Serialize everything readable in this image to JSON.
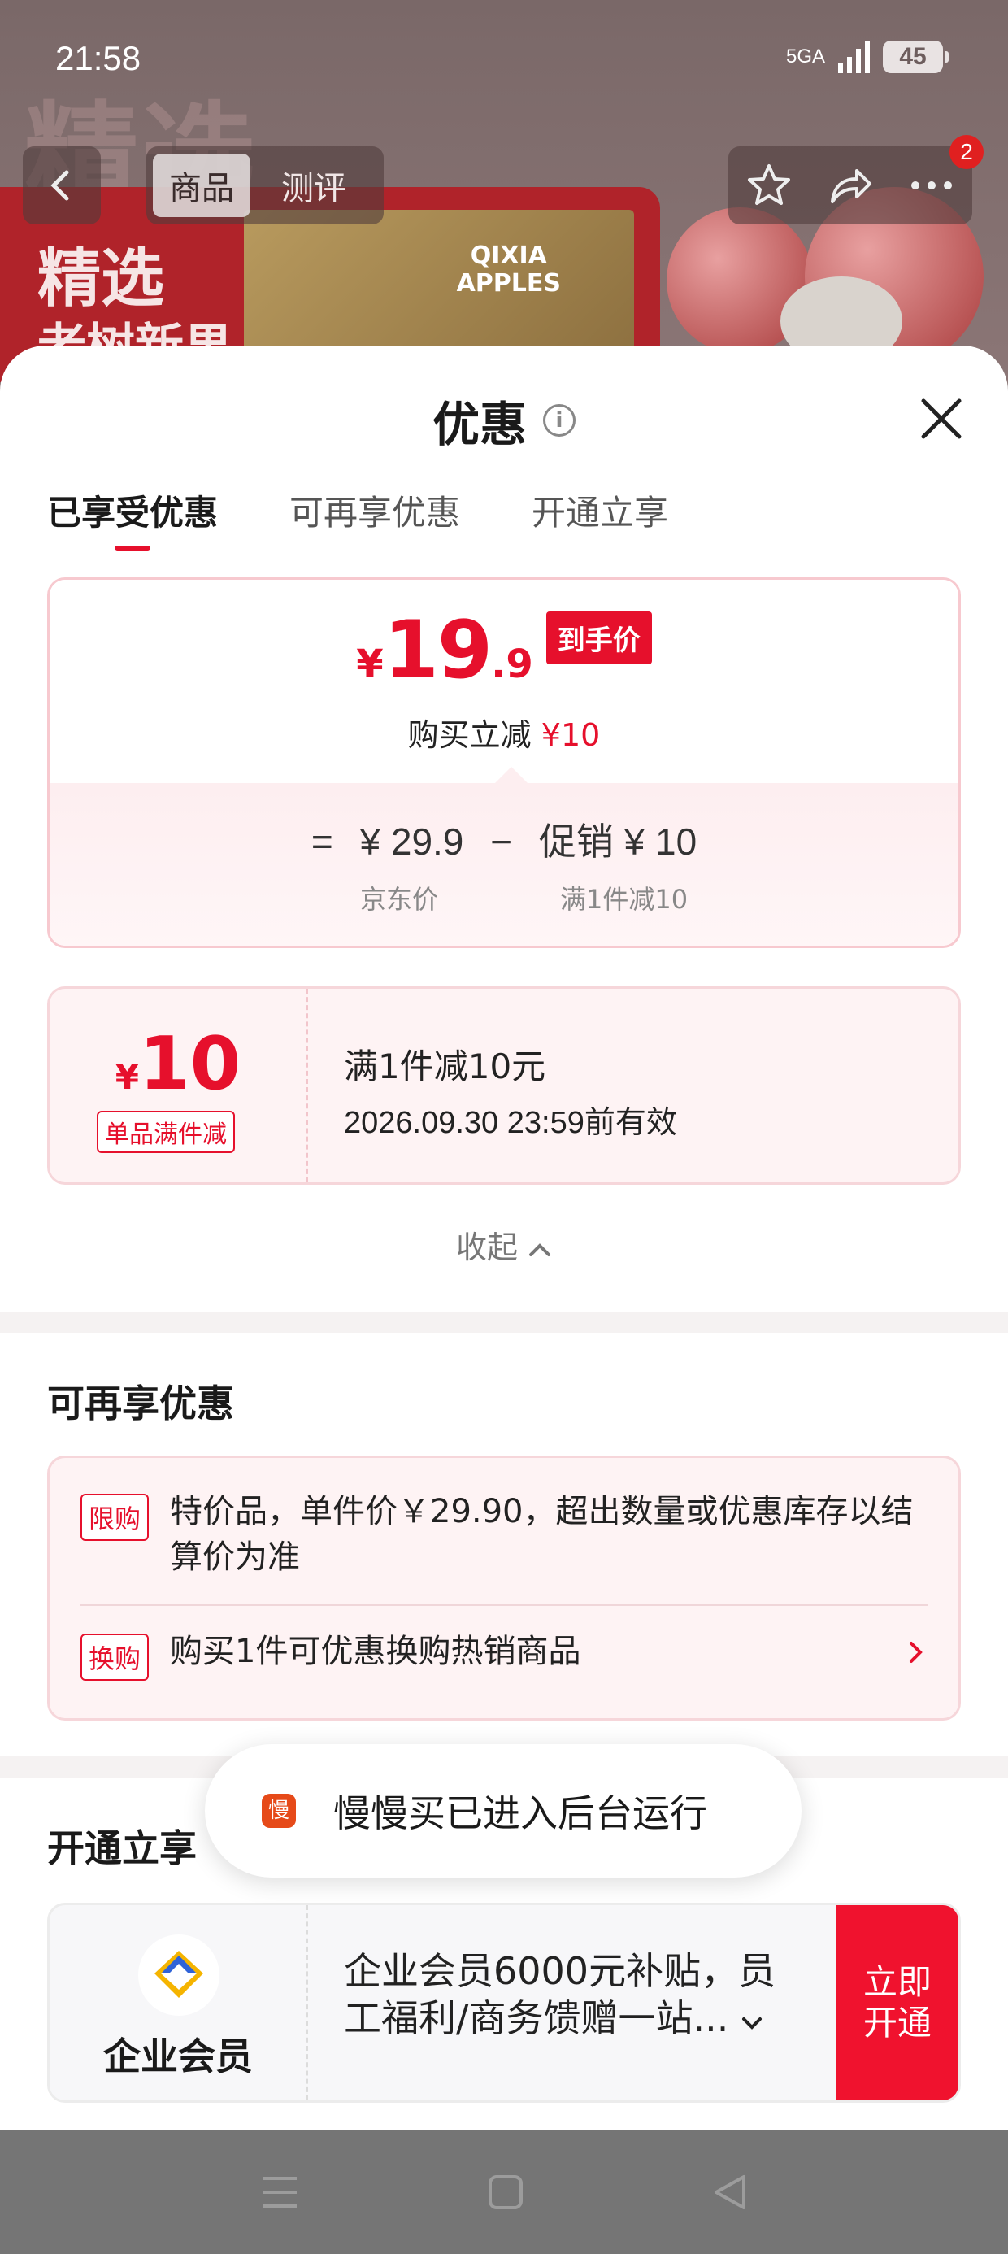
{
  "status_bar": {
    "time": "21:58",
    "network": "5GA",
    "battery": "45"
  },
  "background": {
    "ghost_text": "精选",
    "banner_line1": "精选",
    "banner_line2": "老树新果",
    "box_logo": "QIXIA\nAPPLES"
  },
  "top_nav": {
    "tabs": [
      "商品",
      "测评"
    ],
    "active_tab": 0,
    "badge": "2"
  },
  "sheet": {
    "title": "优惠",
    "tabs": [
      "已享受优惠",
      "可再享优惠",
      "开通立享"
    ]
  },
  "price_card": {
    "currency": "¥",
    "price_int": "19",
    "price_dec": ".9",
    "tag": "到手价",
    "reduce_label": "购买立减",
    "reduce_amount": "¥10",
    "eq": "=",
    "orig_price": "¥ 29.9",
    "minus": "−",
    "promo": "促销 ¥ 10",
    "orig_label": "京东价",
    "promo_label": "满1件减10"
  },
  "coupon": {
    "currency": "¥",
    "amount": "10",
    "tag": "单品满件减",
    "title": "满1件减10元",
    "validity": "2026.09.30 23:59前有效"
  },
  "collapse_label": "收起",
  "more_section": {
    "title": "可再享优惠",
    "items": [
      {
        "pill": "限购",
        "text": "特价品，单件价￥29.90，超出数量或优惠库存以结算价为准"
      },
      {
        "pill": "换购",
        "text": "购买1件可优惠换购热销商品"
      }
    ]
  },
  "open_section": {
    "title": "开通立享",
    "vip_name": "企业会员",
    "vip_desc": "企业会员6000元补贴，员工福利/商务馈赠一站...",
    "vip_button": "立即开通"
  },
  "toast": {
    "icon": "慢",
    "text": "慢慢买已进入后台运行"
  },
  "colors": {
    "accent": "#e6102c",
    "card_bg": "#fef3f4",
    "nav_bar": "#757575"
  }
}
